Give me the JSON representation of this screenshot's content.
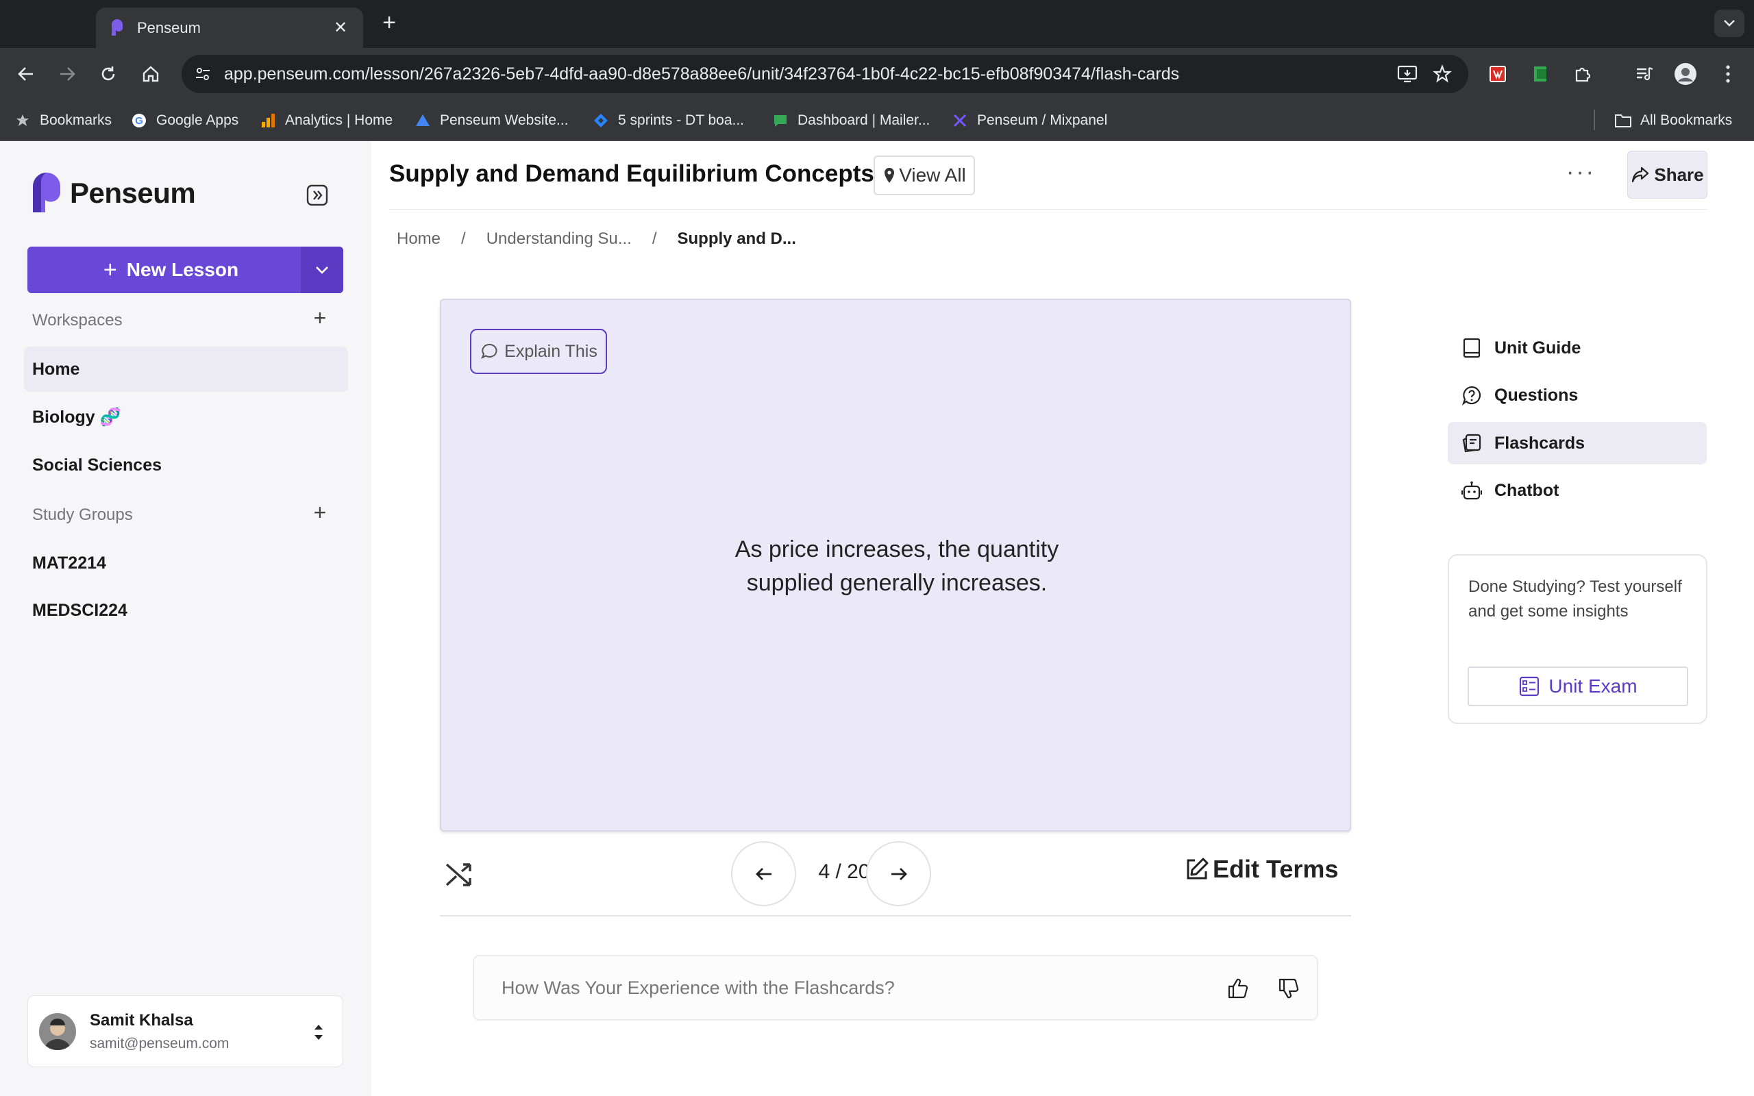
{
  "browser": {
    "tab_title": "Penseum",
    "url": "app.penseum.com/lesson/267a2326-5eb7-4dfd-aa90-d8e578a88ee6/unit/34f23764-1b0f-4c22-bc15-efb08f903474/flash-cards",
    "bookmarks": [
      {
        "label": "Bookmarks",
        "icon": "star-icon"
      },
      {
        "label": "Google Apps",
        "icon": "google-icon"
      },
      {
        "label": "Analytics | Home",
        "icon": "analytics-icon"
      },
      {
        "label": "Penseum Website...",
        "icon": "triangle-icon"
      },
      {
        "label": "5 sprints - DT boa...",
        "icon": "jira-icon"
      },
      {
        "label": "Dashboard | Mailer...",
        "icon": "mailer-icon"
      },
      {
        "label": "Penseum / Mixpanel",
        "icon": "mixpanel-icon"
      }
    ],
    "all_bookmarks": "All Bookmarks"
  },
  "sidebar": {
    "logo": "Penseum",
    "new_lesson": "New Lesson",
    "workspaces_label": "Workspaces",
    "workspace_items": [
      "Home",
      "Biology 🧬",
      "Social Sciences"
    ],
    "study_groups_label": "Study Groups",
    "study_group_items": [
      "MAT2214",
      "MEDSCI224"
    ],
    "user": {
      "name": "Samit Khalsa",
      "email": "samit@penseum.com"
    }
  },
  "header": {
    "title": "Supply and Demand Equilibrium Concepts",
    "view_all": "View All",
    "share": "Share",
    "more": "···"
  },
  "breadcrumb": [
    "Home",
    "Understanding Su...",
    "Supply and D..."
  ],
  "flashcard": {
    "explain_label": "Explain This",
    "text_line1": "As price increases, the quantity",
    "text_line2": "supplied generally increases.",
    "counter": "4 / 20",
    "edit_terms": "Edit Terms"
  },
  "feedback": {
    "question": "How Was Your Experience with the Flashcards?"
  },
  "right_nav": [
    "Unit Guide",
    "Questions",
    "Flashcards",
    "Chatbot"
  ],
  "exam_card": {
    "text": "Done Studying? Test yourself and get some insights",
    "button": "Unit Exam"
  },
  "colors": {
    "accent": "#6a48d7",
    "card_bg": "#ebe9f7",
    "sidebar_bg": "#f6f6f8"
  }
}
